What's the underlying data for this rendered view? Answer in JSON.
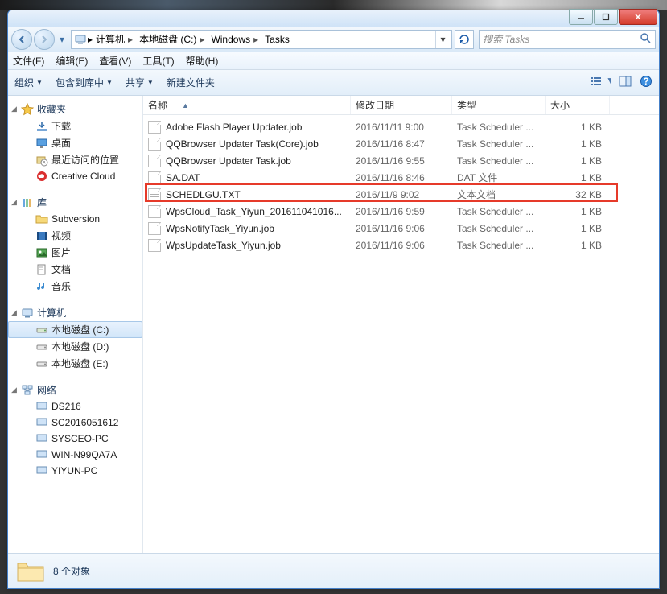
{
  "window": {
    "title": ""
  },
  "nav": {
    "breadcrumb": [
      "计算机",
      "本地磁盘 (C:)",
      "Windows",
      "Tasks"
    ],
    "search_placeholder": "搜索 Tasks"
  },
  "menubar": [
    "文件(F)",
    "编辑(E)",
    "查看(V)",
    "工具(T)",
    "帮助(H)"
  ],
  "toolbar": {
    "organize": "组织",
    "include": "包含到库中",
    "share": "共享",
    "newfolder": "新建文件夹"
  },
  "sidebar": {
    "favorites": {
      "label": "收藏夹",
      "items": [
        "下载",
        "桌面",
        "最近访问的位置",
        "Creative Cloud"
      ]
    },
    "libraries": {
      "label": "库",
      "items": [
        "Subversion",
        "视频",
        "图片",
        "文档",
        "音乐"
      ]
    },
    "computer": {
      "label": "计算机",
      "items": [
        "本地磁盘 (C:)",
        "本地磁盘 (D:)",
        "本地磁盘 (E:)"
      ]
    },
    "network": {
      "label": "网络",
      "items": [
        "DS216",
        "SC2016051612",
        "SYSCEO-PC",
        "WIN-N99QA7A",
        "YIYUN-PC"
      ]
    }
  },
  "columns": {
    "name": "名称",
    "date": "修改日期",
    "type": "类型",
    "size": "大小"
  },
  "files": [
    {
      "name": "Adobe Flash Player Updater.job",
      "date": "2016/11/11 9:00",
      "type": "Task Scheduler ...",
      "size": "1 KB"
    },
    {
      "name": "QQBrowser Updater Task(Core).job",
      "date": "2016/11/16 8:47",
      "type": "Task Scheduler ...",
      "size": "1 KB"
    },
    {
      "name": "QQBrowser Updater Task.job",
      "date": "2016/11/16 9:55",
      "type": "Task Scheduler ...",
      "size": "1 KB"
    },
    {
      "name": "SA.DAT",
      "date": "2016/11/16 8:46",
      "type": "DAT 文件",
      "size": "1 KB"
    },
    {
      "name": "SCHEDLGU.TXT",
      "date": "2016/11/9 9:02",
      "type": "文本文档",
      "size": "32 KB",
      "highlight": true
    },
    {
      "name": "WpsCloud_Task_Yiyun_201611041016...",
      "date": "2016/11/16 9:59",
      "type": "Task Scheduler ...",
      "size": "1 KB"
    },
    {
      "name": "WpsNotifyTask_Yiyun.job",
      "date": "2016/11/16 9:06",
      "type": "Task Scheduler ...",
      "size": "1 KB"
    },
    {
      "name": "WpsUpdateTask_Yiyun.job",
      "date": "2016/11/16 9:06",
      "type": "Task Scheduler ...",
      "size": "1 KB"
    }
  ],
  "statusbar": {
    "count": "8 个对象"
  }
}
